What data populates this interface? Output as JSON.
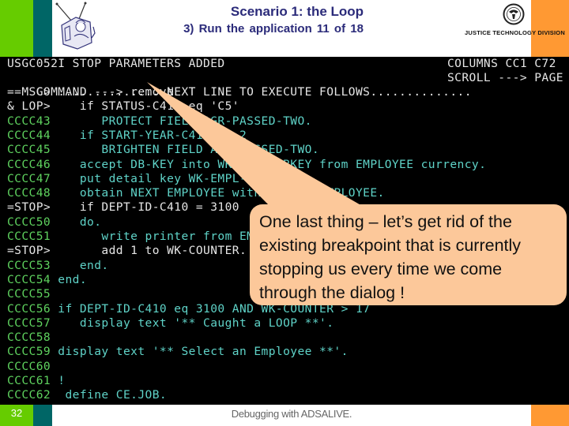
{
  "slide": {
    "title": "Scenario 1: the Loop",
    "subtitle": "3) Run the application  11  of  18",
    "organization": "JUSTICE TECHNOLOGY DIVISION",
    "page_number": "32",
    "footer": "Debugging with ADSALIVE.",
    "colors": {
      "left_bar": "#66cc00",
      "teal_bar": "#006666",
      "right_bar": "#ff9933",
      "title": "#2b2b7a",
      "callout": "#fcc89a"
    }
  },
  "terminal": {
    "status_line": "USGC052I STOP PARAMETERS ADDED",
    "columns_label": "COLUMNS CC1 C72",
    "command_label": "COMMAND --->",
    "command_value": "remove",
    "scroll_label": "SCROLL ---> PAGE",
    "lines": [
      {
        "prefix": "==MSG>",
        "prefix_color": "white",
        "code": " ...............NEXT LINE TO EXECUTE FOLLOWS..............",
        "code_color": "white"
      },
      {
        "prefix": "& LOP>",
        "prefix_color": "white",
        "code": "    if STATUS-C415 eq 'C5'",
        "code_color": "white"
      },
      {
        "prefix": "CCCC43",
        "prefix_color": "green",
        "code": "       PROTECT FIELD AGR-PASSED-TWO.",
        "code_color": "cyan"
      },
      {
        "prefix": "CCCC44",
        "prefix_color": "green",
        "code": "    if START-YEAR-C415 eq 2",
        "code_color": "cyan"
      },
      {
        "prefix": "CCCC45",
        "prefix_color": "green",
        "code": "       BRIGHTEN FIELD AGR-PASSED-TWO.",
        "code_color": "cyan"
      },
      {
        "prefix": "CCCC46",
        "prefix_color": "green",
        "code": "    accept DB-KEY into WK-EMPL-DBKEY from EMPLOYEE currency.",
        "code_color": "cyan"
      },
      {
        "prefix": "CCCC47",
        "prefix_color": "green",
        "code": "    put detail key WK-EMPL-DBKEY.",
        "code_color": "cyan"
      },
      {
        "prefix": "CCCC48",
        "prefix_color": "green",
        "code": "    obtain NEXT EMPLOYEE within DEPT-EMPLOYEE.",
        "code_color": "cyan"
      },
      {
        "prefix": "=STOP>",
        "prefix_color": "white",
        "code": "    if DEPT-ID-C410 = 3100",
        "code_color": "white"
      },
      {
        "prefix": "CCCC50",
        "prefix_color": "green",
        "code": "    do.",
        "code_color": "cyan"
      },
      {
        "prefix": "CCCC51",
        "prefix_color": "green",
        "code": "       write printer from EMPLOYEE.",
        "code_color": "cyan"
      },
      {
        "prefix": "=STOP>",
        "prefix_color": "white",
        "code": "       add 1 to WK-COUNTER.",
        "code_color": "white"
      },
      {
        "prefix": "CCCC53",
        "prefix_color": "green",
        "code": "    end.",
        "code_color": "cyan"
      },
      {
        "prefix": "CCCC54",
        "prefix_color": "green",
        "code": " end.",
        "code_color": "cyan"
      },
      {
        "prefix": "CCCC55",
        "prefix_color": "green",
        "code": "",
        "code_color": "cyan"
      },
      {
        "prefix": "CCCC56",
        "prefix_color": "green",
        "code": " if DEPT-ID-C410 eq 3100 AND WK-COUNTER > 17",
        "code_color": "cyan"
      },
      {
        "prefix": "CCCC57",
        "prefix_color": "green",
        "code": "    display text '** Caught a LOOP **'.",
        "code_color": "cyan"
      },
      {
        "prefix": "CCCC58",
        "prefix_color": "green",
        "code": "",
        "code_color": "cyan"
      },
      {
        "prefix": "CCCC59",
        "prefix_color": "green",
        "code": " display text '** Select an Employee **'.",
        "code_color": "cyan"
      },
      {
        "prefix": "CCCC60",
        "prefix_color": "green",
        "code": "",
        "code_color": "cyan"
      },
      {
        "prefix": "CCCC61",
        "prefix_color": "green",
        "code": " !",
        "code_color": "cyan"
      },
      {
        "prefix": "CCCC62",
        "prefix_color": "green",
        "code": "  define CE.JOB.",
        "code_color": "cyan"
      }
    ]
  },
  "callout": {
    "text": "One last thing – let’s get rid of the existing breakpoint that is currently stopping us every time we come through the dialog !",
    "lines": [
      "One last thing – let’s get rid of the",
      "existing breakpoint that is currently",
      "stopping us every time we come",
      "through the dialog !"
    ]
  },
  "icons": {
    "logo": "tv-mascot-icon",
    "seal": "justice-seal-icon"
  }
}
